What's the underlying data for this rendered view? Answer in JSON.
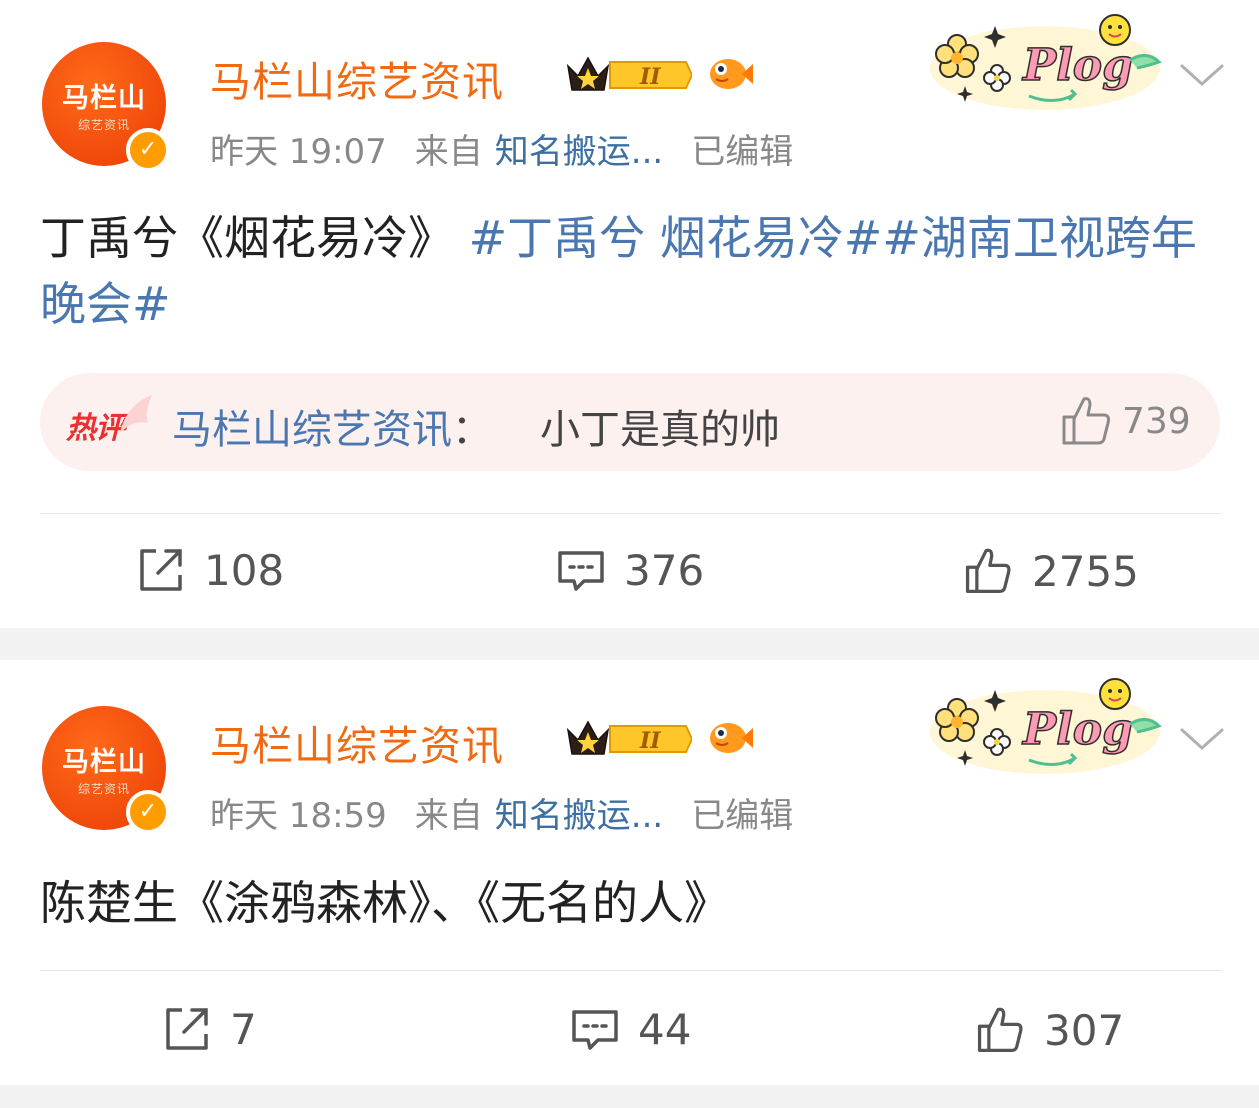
{
  "posts": [
    {
      "author": "马栏山综艺资讯",
      "avatar_text": "马栏山",
      "avatar_sub": "综艺资讯",
      "level_badge": "II",
      "time": "昨天 19:07",
      "source_prefix": "来自",
      "source": "知名搬运...",
      "edited": "已编辑",
      "text": "丁禹兮《烟花易冷》",
      "topics": "#丁禹兮 烟花易冷##湖南卫视跨年晚会#",
      "hot_comment": {
        "tag": "热评",
        "author": "马栏山综艺资讯",
        "text": "小丁是真的帅",
        "likes": "739"
      },
      "reposts": "108",
      "comments": "376",
      "likes": "2755"
    },
    {
      "author": "马栏山综艺资讯",
      "avatar_text": "马栏山",
      "avatar_sub": "综艺资讯",
      "level_badge": "II",
      "time": "昨天 18:59",
      "source_prefix": "来自",
      "source": "知名搬运...",
      "edited": "已编辑",
      "text": "陈楚生《涂鸦森林》、《无名的人》",
      "reposts": "7",
      "comments": "44",
      "likes": "307"
    }
  ],
  "sticker_text": "Plog",
  "colors": {
    "username": "#f06a13",
    "link": "#4a77b0",
    "hot_tag": "#ec2f2f",
    "verify": "#ff9d00"
  },
  "icons": [
    "crown-badge-icon",
    "fish-icon",
    "plog-sticker-icon",
    "chevron-down-icon",
    "repost-icon",
    "comment-icon",
    "like-icon",
    "verified-icon"
  ]
}
